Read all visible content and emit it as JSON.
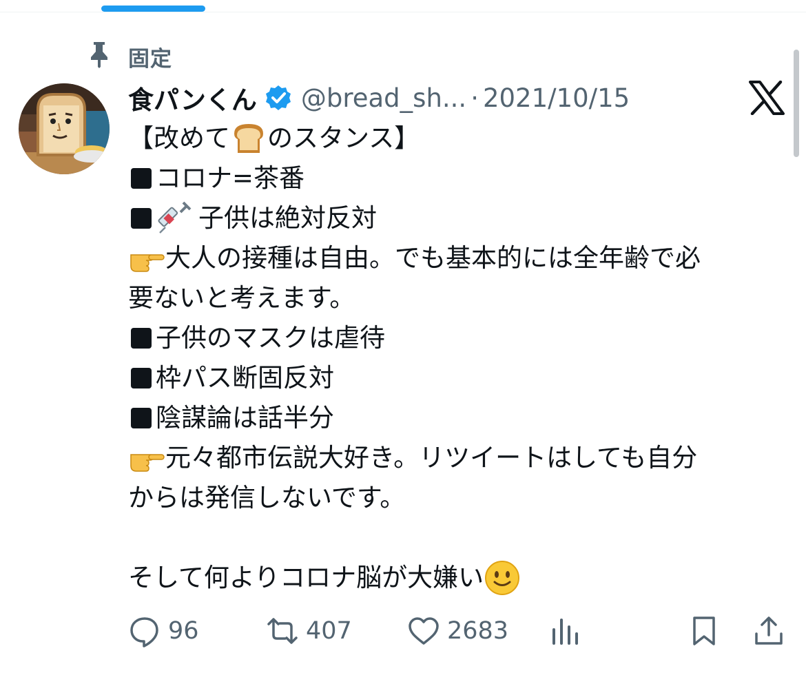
{
  "pinned": {
    "label": "固定"
  },
  "tweet": {
    "display_name": "食パンくん",
    "handle": "@bread_sh...",
    "separator": "·",
    "date": "2021/10/15",
    "lines": {
      "l1_open": "【改めて",
      "l1_close": "のスタンス】",
      "l2": "コロナ=茶番",
      "l3": "子供は絶対反対",
      "l4": "大人の接種は自由。でも基本的には全年齢で必",
      "l5": "要ないと考えます。",
      "l6": "子供のマスクは虐待",
      "l7": "枠パス断固反対",
      "l8": "陰謀論は話半分",
      "l9": "元々都市伝説大好き。リツイートはしても自分",
      "l10": "からは発信しないです。",
      "l11": "そして何よりコロナ脳が大嫌い"
    }
  },
  "actions": {
    "replies": "96",
    "retweets": "407",
    "likes": "2683"
  },
  "icons": {
    "pin": "pin-icon",
    "verified": "verified-badge-icon",
    "brand": "x-logo-icon",
    "reply": "reply-icon",
    "retweet": "retweet-icon",
    "like": "heart-icon",
    "views": "views-chart-icon",
    "bookmark": "bookmark-icon",
    "share": "share-icon"
  },
  "colors": {
    "accent": "#1d9bf0",
    "text": "#0f1419",
    "secondary": "#536471"
  }
}
